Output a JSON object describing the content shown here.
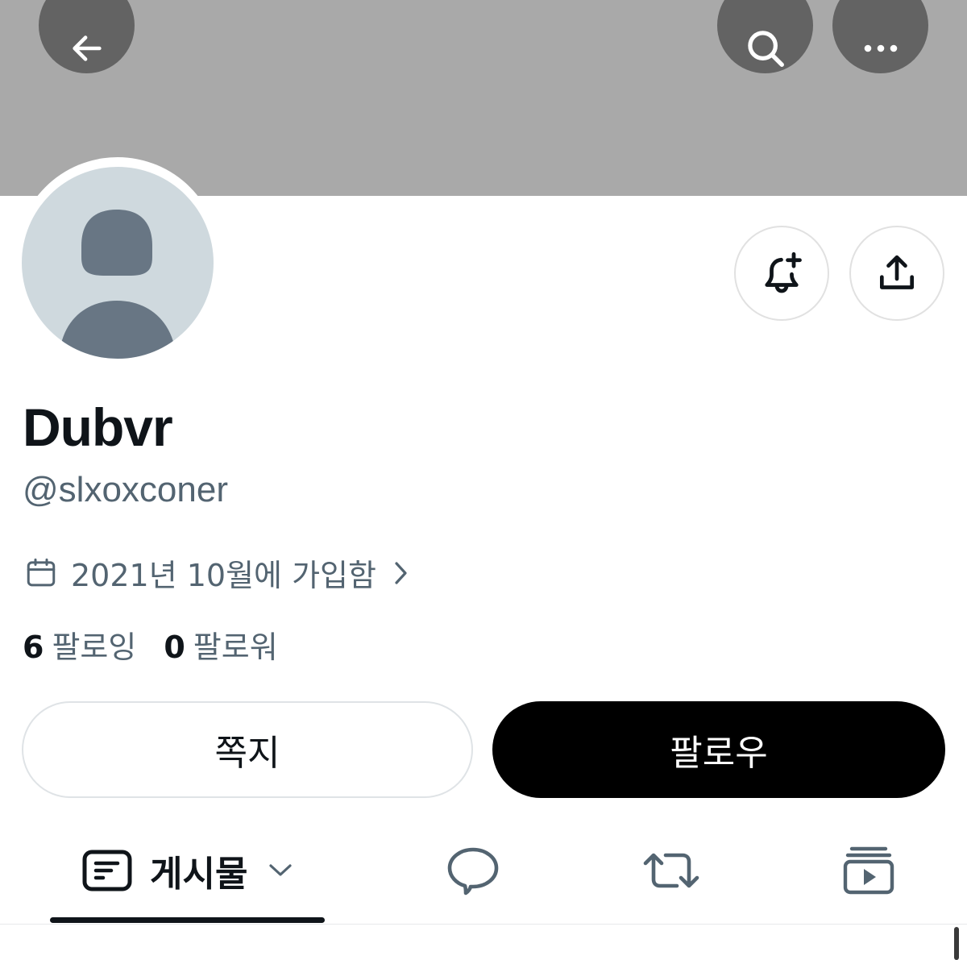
{
  "header": {
    "back_icon": "arrow-left-icon",
    "search_icon": "search-icon",
    "more_icon": "more-horizontal-icon",
    "banner_color": "#a9a9a9"
  },
  "profile": {
    "display_name": "Dubvr",
    "handle": "@slxoxconer",
    "joined": "2021년 10월에 가입함",
    "following_count": "6",
    "following_label": "팔로잉",
    "followers_count": "0",
    "followers_label": "팔로워"
  },
  "actions": {
    "notify_icon": "bell-plus-icon",
    "share_icon": "share-icon",
    "message_label": "쪽지",
    "follow_label": "팔로우"
  },
  "tabs": [
    {
      "label": "게시물",
      "icon": "posts-icon",
      "active": true
    },
    {
      "icon": "reply-bubble-icon"
    },
    {
      "icon": "repost-icon"
    },
    {
      "icon": "media-play-icon"
    }
  ],
  "colors": {
    "primary_text": "#0f1419",
    "secondary_text": "#536471",
    "follow_button": "#000000"
  }
}
